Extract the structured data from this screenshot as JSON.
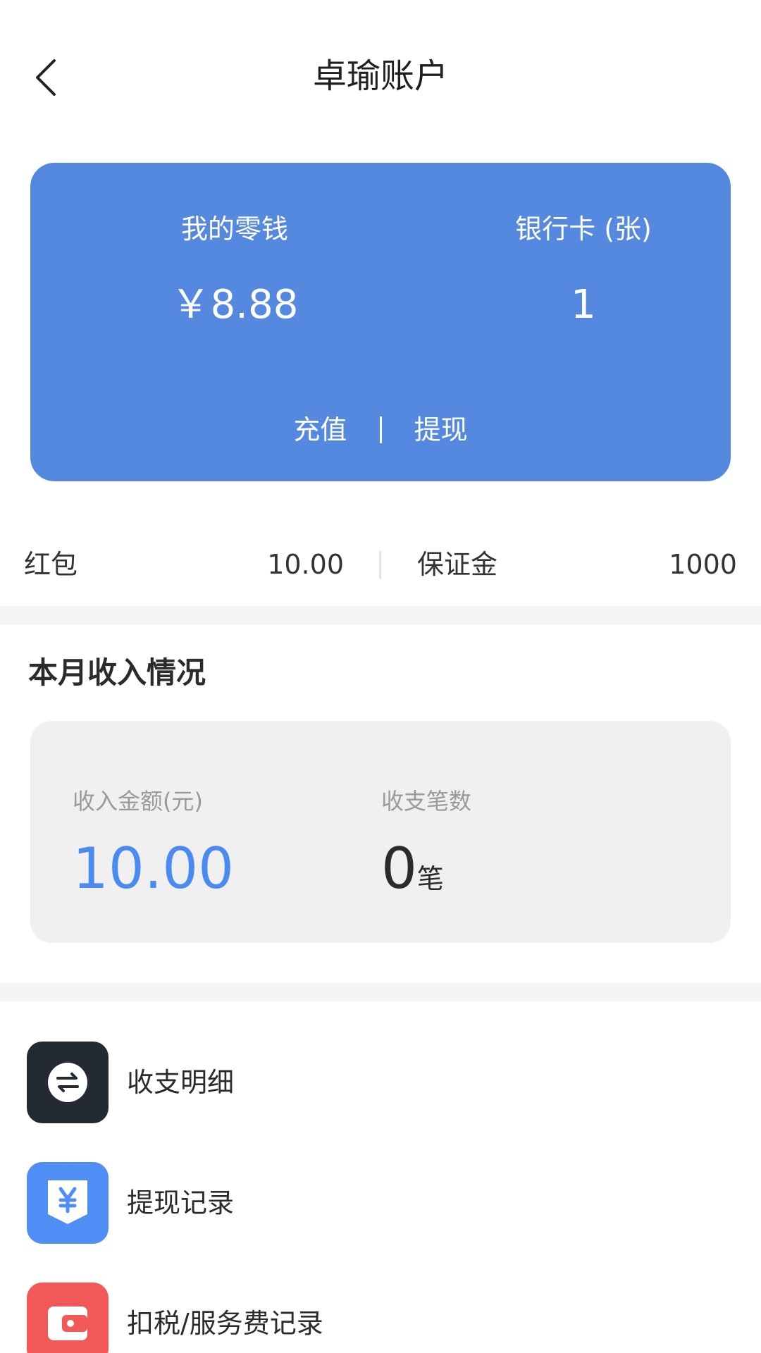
{
  "header": {
    "title": "卓瑜账户"
  },
  "balance_card": {
    "wallet_label": "我的零钱",
    "wallet_value": "￥8.88",
    "bank_label": "银行卡 (张)",
    "bank_value": "1",
    "recharge_label": "充值",
    "withdraw_label": "提现",
    "card_color": "#5589e0"
  },
  "stats": {
    "red_packet_label": "红包",
    "red_packet_value": "10.00",
    "deposit_label": "保证金",
    "deposit_value": "1000"
  },
  "income": {
    "section_title": "本月收入情况",
    "amount_label": "收入金额(元)",
    "amount_value": "10.00",
    "count_label": "收支笔数",
    "count_value": "0",
    "count_unit": "笔",
    "amount_color": "#4b8af0"
  },
  "menu": {
    "items": [
      {
        "label": "收支明细",
        "icon": "transfer-icon",
        "color": "#232a33"
      },
      {
        "label": "提现记录",
        "icon": "yuan-download-icon",
        "color": "#4f8ef5"
      },
      {
        "label": "扣税/服务费记录",
        "icon": "wallet-icon",
        "color": "#f25858"
      }
    ]
  }
}
